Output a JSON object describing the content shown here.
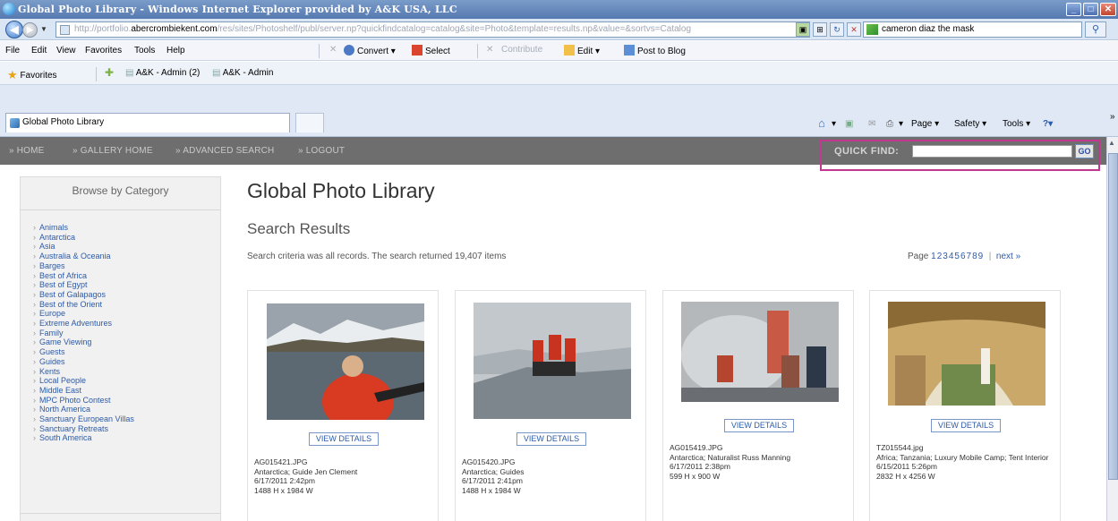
{
  "window": {
    "title": "Global Photo Library - Windows Internet Explorer provided by A&K USA, LLC"
  },
  "address_bar": {
    "url_prefix": "http://portfolio.",
    "url_domain": "abercrombiekent.com",
    "url_rest": "/res/sites/Photoshelf/publ/server.np?quickfindcatalog=catalog&site=Photo&template=results.np&value=&sortvs=Catalog"
  },
  "search_bar": {
    "value": "cameron diaz the mask"
  },
  "menu": {
    "items": [
      "File",
      "Edit",
      "View",
      "Favorites",
      "Tools",
      "Help"
    ],
    "toolbar": {
      "convert": "Convert",
      "select": "Select",
      "contribute": "Contribute",
      "edit": "Edit",
      "post_to_blog": "Post to Blog"
    }
  },
  "favorites": {
    "label": "Favorites",
    "items": [
      "A&K - Admin (2)",
      "A&K - Admin"
    ]
  },
  "tab": {
    "label": "Global Photo Library"
  },
  "command_bar": {
    "page": "Page",
    "safety": "Safety",
    "tools": "Tools"
  },
  "site_nav": {
    "links": [
      "HOME",
      "GALLERY HOME",
      "ADVANCED SEARCH",
      "LOGOUT"
    ],
    "quick_find_label": "QUICK FIND:",
    "go_label": "GO"
  },
  "sidebar": {
    "heading": "Browse by Category",
    "categories": [
      "Animals",
      "Antarctica",
      "Asia",
      "Australia & Oceania",
      "Barges",
      "Best of Africa",
      "Best of Egypt",
      "Best of Galapagos",
      "Best of the Orient",
      "Europe",
      "Extreme Adventures",
      "Family",
      "Game Viewing",
      "Guests",
      "Guides",
      "Kents",
      "Local People",
      "Middle East",
      "MPC Photo Contest",
      "North America",
      "Sanctuary European Villas",
      "Sanctuary Retreats",
      "South America"
    ]
  },
  "main": {
    "page_title": "Global Photo Library",
    "section_title": "Search Results",
    "criteria_text": "Search criteria was all records.   The search returned 19,407 items",
    "pager": {
      "label": "Page",
      "pages": [
        "1",
        "2",
        "3",
        "4",
        "5",
        "6",
        "7",
        "8",
        "9"
      ],
      "next": "next »"
    },
    "view_details_label": "VIEW DETAILS",
    "results": [
      {
        "filename": "AG015421.JPG",
        "caption": "Antarctica; Guide Jen Clement",
        "date": "6/17/2011 2:42pm",
        "dimensions": "1488 H x 1984 W",
        "photo_colors": [
          "#9aa3ab",
          "#5c6973",
          "#d83a22"
        ]
      },
      {
        "filename": "AG015420.JPG",
        "caption": "Antarctica; Guides",
        "date": "6/17/2011 2:41pm",
        "dimensions": "1488 H x 1984 W",
        "photo_colors": [
          "#c3c8cd",
          "#7e868d",
          "#c8331f"
        ]
      },
      {
        "filename": "AG015419.JPG",
        "caption": "Antarctica; Naturalist Russ Manning",
        "date": "6/17/2011 2:38pm",
        "dimensions": "599 H x 900 W",
        "photo_colors": [
          "#b5b8bb",
          "#6a6e72",
          "#c85a45"
        ]
      },
      {
        "filename": "TZ015544.jpg",
        "caption": "Africa; Tanzania; Luxury Mobile Camp; Tent Interior",
        "date": "6/15/2011 5:26pm",
        "dimensions": "2832 H x 4256 W",
        "photo_colors": [
          "#c9a86a",
          "#8b6a36",
          "#6f8a4a"
        ]
      }
    ]
  },
  "colors": {
    "nav_bar": "#6e6e6e",
    "quick_find_highlight": "#c2378f",
    "link": "#2d5ba8"
  }
}
